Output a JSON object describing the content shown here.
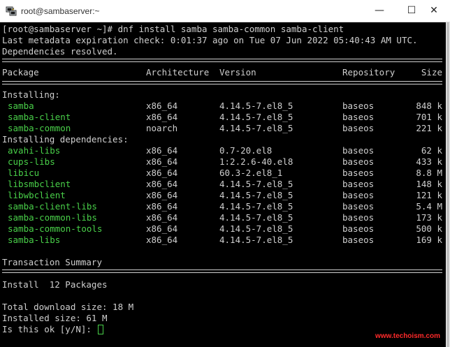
{
  "window": {
    "title": "root@sambaserver:~",
    "minimize_glyph": "—",
    "maximize_glyph": "☐",
    "close_glyph": "✕",
    "icon": "putty-terminal-icon"
  },
  "terminal": {
    "command_line": "[root@sambaserver ~]# dnf install samba samba-common samba-client",
    "metadata_line": "Last metadata expiration check: 0:01:37 ago on Tue 07 Jun 2022 05:40:43 AM UTC.",
    "deps_resolved": "Dependencies resolved.",
    "headers": [
      "Package",
      "Architecture",
      "Version",
      "Repository",
      "Size"
    ],
    "installing_label": "Installing:",
    "installing": [
      {
        "name": "samba",
        "arch": "x86_64",
        "version": "4.14.5-7.el8_5",
        "repo": "baseos",
        "size": "848 k"
      },
      {
        "name": "samba-client",
        "arch": "x86_64",
        "version": "4.14.5-7.el8_5",
        "repo": "baseos",
        "size": "701 k"
      },
      {
        "name": "samba-common",
        "arch": "noarch",
        "version": "4.14.5-7.el8_5",
        "repo": "baseos",
        "size": "221 k"
      }
    ],
    "deps_label": "Installing dependencies:",
    "dependencies": [
      {
        "name": "avahi-libs",
        "arch": "x86_64",
        "version": "0.7-20.el8",
        "repo": "baseos",
        "size": "62 k"
      },
      {
        "name": "cups-libs",
        "arch": "x86_64",
        "version": "1:2.2.6-40.el8",
        "repo": "baseos",
        "size": "433 k"
      },
      {
        "name": "libicu",
        "arch": "x86_64",
        "version": "60.3-2.el8_1",
        "repo": "baseos",
        "size": "8.8 M"
      },
      {
        "name": "libsmbclient",
        "arch": "x86_64",
        "version": "4.14.5-7.el8_5",
        "repo": "baseos",
        "size": "148 k"
      },
      {
        "name": "libwbclient",
        "arch": "x86_64",
        "version": "4.14.5-7.el8_5",
        "repo": "baseos",
        "size": "121 k"
      },
      {
        "name": "samba-client-libs",
        "arch": "x86_64",
        "version": "4.14.5-7.el8_5",
        "repo": "baseos",
        "size": "5.4 M"
      },
      {
        "name": "samba-common-libs",
        "arch": "x86_64",
        "version": "4.14.5-7.el8_5",
        "repo": "baseos",
        "size": "173 k"
      },
      {
        "name": "samba-common-tools",
        "arch": "x86_64",
        "version": "4.14.5-7.el8_5",
        "repo": "baseos",
        "size": "500 k"
      },
      {
        "name": "samba-libs",
        "arch": "x86_64",
        "version": "4.14.5-7.el8_5",
        "repo": "baseos",
        "size": "169 k"
      }
    ],
    "summary_label": "Transaction Summary",
    "install_summary": "Install  12 Packages",
    "download_size": "Total download size: 18 M",
    "installed_size": "Installed size: 61 M",
    "prompt": "Is this ok [y/N]: "
  },
  "colors": {
    "background": "#000000",
    "text": "#cfcfcf",
    "package": "#49d049",
    "watermark": "#ff2a2a"
  },
  "watermark": "www.techoism.com"
}
